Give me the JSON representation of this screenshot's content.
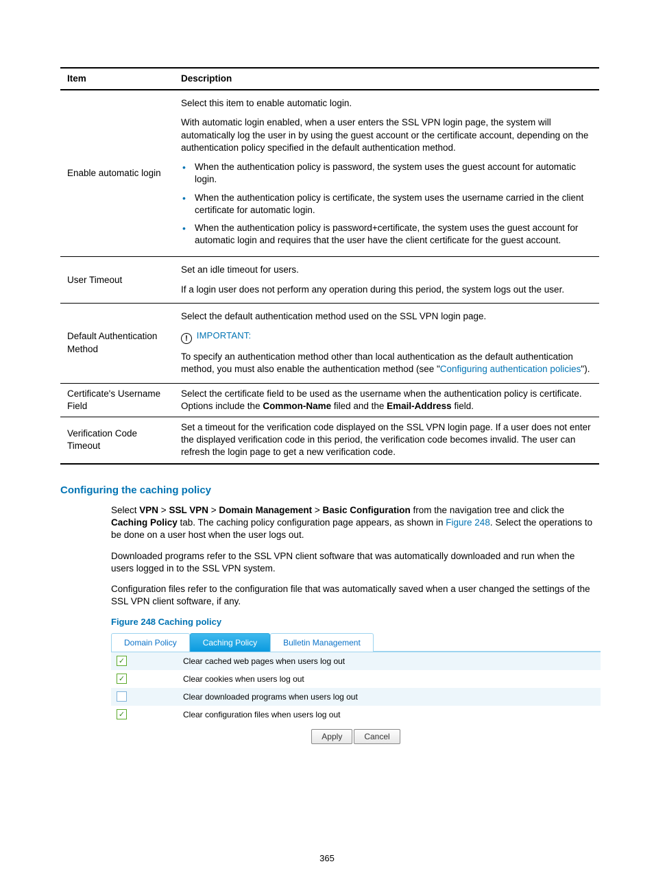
{
  "table": {
    "headers": {
      "item": "Item",
      "desc": "Description"
    },
    "rows": {
      "r1": {
        "item": "Enable automatic login",
        "p1": "Select this item to enable automatic login.",
        "p2": "With automatic login enabled, when a user enters the SSL VPN login page, the system will automatically log the user in by using the guest account or the certificate account, depending on the authentication policy specified in the default authentication method.",
        "b1": "When the authentication policy is password, the system uses the guest account for automatic login.",
        "b2": "When the authentication policy is certificate, the system uses the username carried in the client certificate for automatic login.",
        "b3": "When the authentication policy is password+certificate, the system uses the guest account for automatic login and requires that the user have the client certificate for the guest account."
      },
      "r2": {
        "item": "User Timeout",
        "p1": "Set an idle timeout for users.",
        "p2": "If a login user does not perform any operation during this period, the system logs out the user."
      },
      "r3": {
        "item": "Default Authentication Method",
        "p1": "Select the default authentication method used on the SSL VPN login page.",
        "imp_icon": "!",
        "imp_label": "IMPORTANT:",
        "p2a": "To specify an authentication method other than local authentication as the default authentication method, you must also enable the authentication method (see \"",
        "p2link": "Configuring authentication policies",
        "p2b": "\")."
      },
      "r4": {
        "item": "Certificate's Username Field",
        "p_a": "Select the certificate field to be used as the username when the authentication policy is certificate. Options include the ",
        "bold1": "Common-Name",
        "p_b": " filed and the ",
        "bold2": "Email-Address",
        "p_c": " field."
      },
      "r5": {
        "item": "Verification Code Timeout",
        "p": "Set a timeout for the verification code displayed on the SSL VPN login page. If a user does not enter the displayed verification code in this period, the verification code becomes invalid. The user can refresh the login page to get a new verification code."
      }
    }
  },
  "section_heading": "Configuring the caching policy",
  "body": {
    "p1a": "Select ",
    "b1": "VPN",
    "sep1": " > ",
    "b2": "SSL VPN",
    "sep2": " > ",
    "b3": "Domain Management",
    "sep3": " > ",
    "b4": "Basic Configuration",
    "p1b": " from the navigation tree and click the ",
    "b5": "Caching Policy",
    "p1c": " tab. The caching policy configuration page appears, as shown in ",
    "figlink": "Figure 248",
    "p1d": ". Select the operations to be done on a user host when the user logs out.",
    "p2": "Downloaded programs refer to the SSL VPN client software that was automatically downloaded and run when the users logged in to the SSL VPN system.",
    "p3": "Configuration files refer to the configuration file that was automatically saved when a user changed the settings of the SSL VPN client software, if any."
  },
  "figure": {
    "caption": "Figure 248 Caching policy",
    "tabs": {
      "t1": "Domain Policy",
      "t2": "Caching Policy",
      "t3": "Bulletin Management"
    },
    "options": {
      "o1": {
        "checked": true,
        "label": "Clear cached web pages when users log out"
      },
      "o2": {
        "checked": true,
        "label": "Clear cookies when users log out"
      },
      "o3": {
        "checked": false,
        "label": "Clear downloaded programs when users log out"
      },
      "o4": {
        "checked": true,
        "label": "Clear configuration files when users log out"
      }
    },
    "buttons": {
      "apply": "Apply",
      "cancel": "Cancel"
    }
  },
  "page_number": "365"
}
